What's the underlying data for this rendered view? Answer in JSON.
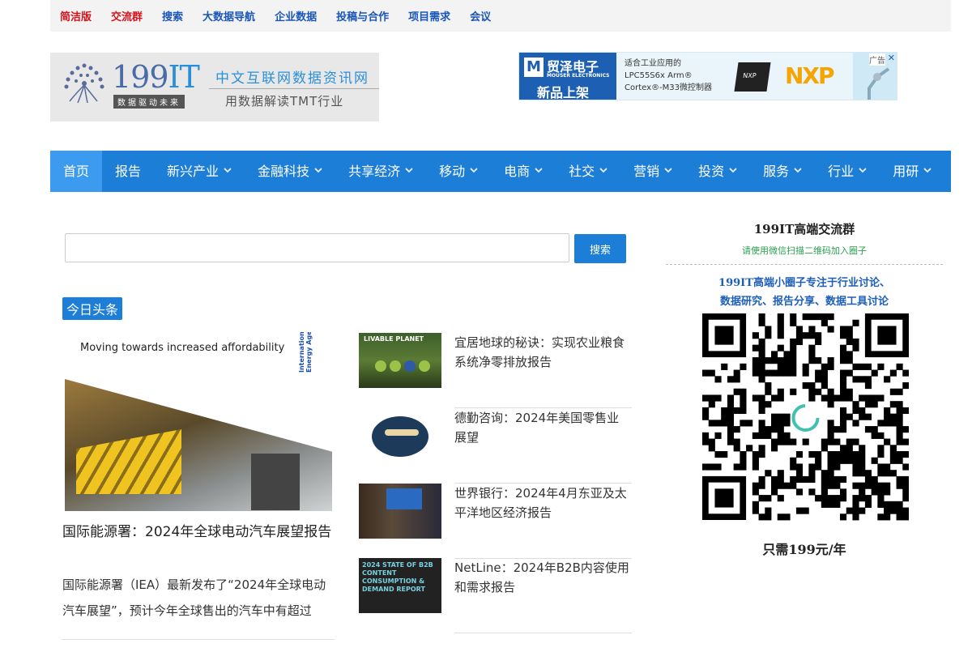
{
  "topbar": {
    "links": [
      {
        "label": "简洁版",
        "color": "#d6121b"
      },
      {
        "label": "交流群",
        "color": "#d6121b"
      },
      {
        "label": "搜索",
        "color": "#1a56b8"
      },
      {
        "label": "大数据导航",
        "color": "#1a56b8"
      },
      {
        "label": "企业数据",
        "color": "#1a56b8"
      },
      {
        "label": "投稿与合作",
        "color": "#1a56b8"
      },
      {
        "label": "项目需求",
        "color": "#1a56b8"
      },
      {
        "label": "会议",
        "color": "#1a56b8"
      }
    ]
  },
  "logo": {
    "brand_num": "199",
    "brand_it": "IT",
    "tagline": "数据驱动未来",
    "title_cn": "中文互联网数据资讯网",
    "subtitle_cn": "用数据解读TMT行业"
  },
  "ad": {
    "brand_cn": "贸泽电子",
    "brand_en": "MOUSER ELECTRONICS",
    "brand_sub": "新品上架",
    "line1": "适合工业应用的",
    "line2": "LPC55S6x Arm®",
    "line3": "Cortex®-M33微控制器",
    "chip": "NXP",
    "nxp": "NXP",
    "label": "广告",
    "close": "✕"
  },
  "nav": {
    "items": [
      {
        "label": "首页",
        "active": true,
        "dropdown": false
      },
      {
        "label": "报告",
        "active": false,
        "dropdown": false
      },
      {
        "label": "新兴产业",
        "active": false,
        "dropdown": true
      },
      {
        "label": "金融科技",
        "active": false,
        "dropdown": true
      },
      {
        "label": "共享经济",
        "active": false,
        "dropdown": true
      },
      {
        "label": "移动",
        "active": false,
        "dropdown": true
      },
      {
        "label": "电商",
        "active": false,
        "dropdown": true
      },
      {
        "label": "社交",
        "active": false,
        "dropdown": true
      },
      {
        "label": "营销",
        "active": false,
        "dropdown": true
      },
      {
        "label": "投资",
        "active": false,
        "dropdown": true
      },
      {
        "label": "服务",
        "active": false,
        "dropdown": true
      },
      {
        "label": "行业",
        "active": false,
        "dropdown": true
      },
      {
        "label": "用研",
        "active": false,
        "dropdown": true
      }
    ],
    "chevron": "⌄"
  },
  "search": {
    "value": "",
    "placeholder": "",
    "button": "搜索"
  },
  "headline": {
    "badge": "今日头条",
    "image_caption": "Moving towards increased affordability",
    "image_org": "International Energy Agency",
    "title": "国际能源署：2024年全球电动汽车展望报告",
    "desc": "国际能源署（IEA）最新发布了“2024年全球电动汽车展望”，预计今年全球售出的汽车中有超过"
  },
  "news": [
    {
      "title": "宜居地球的秘诀：实现农业粮食系统净零排放报告",
      "thumb_text": "LIVABLE PLANET"
    },
    {
      "title": "德勤咨询：2024年美国零售业展望",
      "thumb_text": ""
    },
    {
      "title": "世界银行：2024年4月东亚及太平洋地区经济报告",
      "thumb_text": ""
    },
    {
      "title": "NetLine：2024年B2B内容使用和需求报告",
      "thumb_text": "2024 STATE OF B2B CONTENT CONSUMPTION & DEMAND REPORT"
    }
  ],
  "sidebar": {
    "title": "199IT高端交流群",
    "scan_hint": "请使用微信扫描二维码加入圈子",
    "desc1": "199IT高端小圈子专注于行业讨论、",
    "desc2": "数据研究、报告分享、数据工具讨论",
    "price": "只需199元/年"
  }
}
